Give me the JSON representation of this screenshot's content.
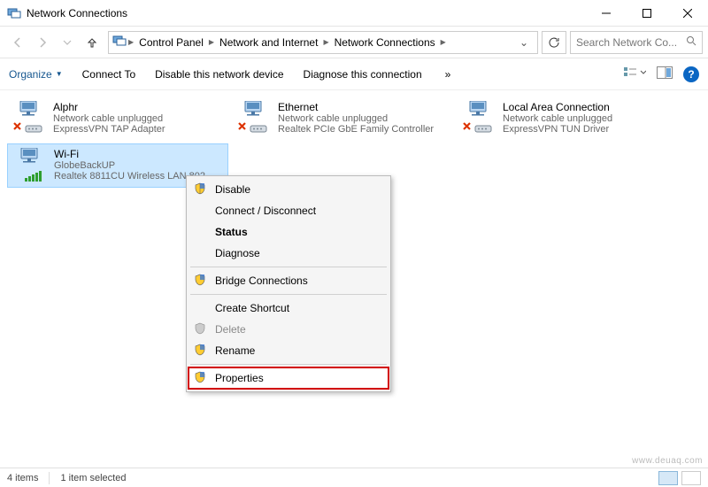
{
  "window": {
    "title": "Network Connections"
  },
  "breadcrumb": {
    "items": [
      "Control Panel",
      "Network and Internet",
      "Network Connections"
    ]
  },
  "search": {
    "placeholder": "Search Network Co..."
  },
  "toolbar": {
    "organize": "Organize",
    "connect_to": "Connect To",
    "disable": "Disable this network device",
    "diagnose": "Diagnose this connection",
    "more": "»"
  },
  "connections": [
    {
      "name": "Alphr",
      "status": "Network cable unplugged",
      "device": "ExpressVPN TAP Adapter",
      "state": "unplugged",
      "selected": false
    },
    {
      "name": "Ethernet",
      "status": "Network cable unplugged",
      "device": "Realtek PCIe GbE Family Controller",
      "state": "unplugged",
      "selected": false
    },
    {
      "name": "Local Area Connection",
      "status": "Network cable unplugged",
      "device": "ExpressVPN TUN Driver",
      "state": "unplugged",
      "selected": false
    },
    {
      "name": "Wi-Fi",
      "status": "GlobeBackUP",
      "device": "Realtek 8811CU Wireless LAN 802...",
      "state": "connected",
      "selected": true
    }
  ],
  "contextmenu": {
    "disable": "Disable",
    "connect": "Connect / Disconnect",
    "status": "Status",
    "diagnose": "Diagnose",
    "bridge": "Bridge Connections",
    "shortcut": "Create Shortcut",
    "delete": "Delete",
    "rename": "Rename",
    "properties": "Properties"
  },
  "statusbar": {
    "count": "4 items",
    "selected": "1 item selected"
  },
  "watermark": "www.deuaq.com"
}
